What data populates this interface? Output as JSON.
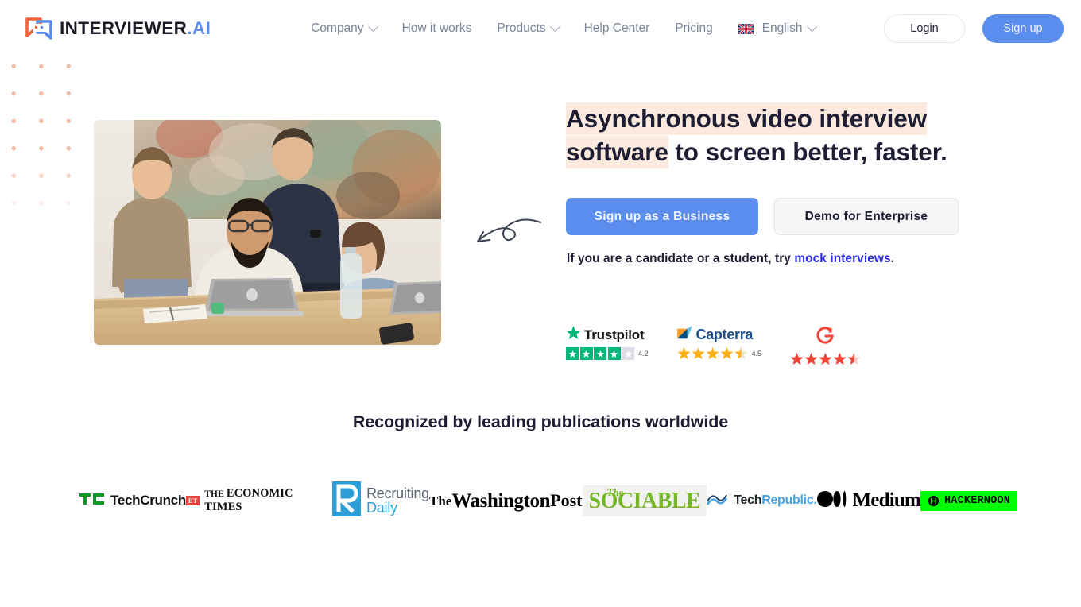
{
  "brand": {
    "logo_icon": "chat-bubbles-icon",
    "name_main": "INTERVIEWER",
    "name_suffix": ".AI",
    "accent_blue": "#5b8def",
    "accent_orange": "#f4623a",
    "highlight_peach": "#fdeadf"
  },
  "header": {
    "nav": [
      {
        "label": "Company",
        "has_dropdown": true
      },
      {
        "label": "How it works",
        "has_dropdown": false
      },
      {
        "label": "Products",
        "has_dropdown": true
      },
      {
        "label": "Help Center",
        "has_dropdown": false
      },
      {
        "label": "Pricing",
        "has_dropdown": false
      },
      {
        "label": "English",
        "has_dropdown": true,
        "icon": "uk-flag-icon"
      }
    ],
    "login_label": "Login",
    "signup_label": "Sign up"
  },
  "hero": {
    "headline_highlight": "Asynchronous video interview software",
    "headline_rest": " to screen better, faster.",
    "headline_line1_highlight": "Asynchronous video interview",
    "headline_line2_highlight": "software",
    "headline_line2_rest": " to screen better, faster.",
    "primary_cta": "Sign up as a Business",
    "secondary_cta": "Demo for Enterprise",
    "candidate_text": "If you are a candidate or a student, try ",
    "candidate_link": "mock interviews",
    "candidate_period": ".",
    "image_alt": "team-collaborating-around-laptops-photo",
    "arrow_icon": "curly-arrow-left-icon"
  },
  "reviews": [
    {
      "platform": "Trustpilot",
      "icon": "trustpilot-star-icon",
      "rating": "4.2",
      "filled": 4,
      "half": 0,
      "total": 5,
      "color": "#00b67a"
    },
    {
      "platform": "Capterra",
      "icon": "capterra-arrow-icon",
      "rating": "4.5",
      "filled": 4,
      "half": 1,
      "total": 5,
      "color": "#ff9d28"
    },
    {
      "platform": "G2",
      "icon": "g2-logo-icon",
      "rating": "",
      "filled": 4,
      "half": 1,
      "total": 5,
      "color": "#ef4438"
    }
  ],
  "publications": {
    "heading": "Recognized by leading publications worldwide",
    "logos": [
      {
        "name": "TechCrunch",
        "part1": "Tech",
        "part2": "Crunch",
        "icon": "techcrunch-logo-icon"
      },
      {
        "name": "The Economic Times",
        "badge": "ET",
        "text_small": "THE ",
        "text_main": "ECONOMIC TIMES",
        "icon": "economic-times-logo-icon"
      },
      {
        "name": "Recruiting Daily",
        "line1": "Recruiting",
        "line2": "Daily",
        "icon": "recruiting-daily-logo-icon"
      },
      {
        "name": "The Washington Post",
        "line1": "The",
        "line2": "Washington",
        "line3": "Post",
        "icon": "washington-post-logo-icon"
      },
      {
        "name": "The Sociable",
        "small": "The",
        "main": "SOCIABLE",
        "icon": "sociable-logo-icon"
      },
      {
        "name": "TechRepublic",
        "part1": "Tech",
        "part2": "Republic.",
        "icon": "techrepublic-logo-icon"
      },
      {
        "name": "Medium",
        "text": "Medium",
        "icon": "medium-logo-icon"
      },
      {
        "name": "HackerNoon",
        "text": "HACKERNOON",
        "icon": "hackernoon-logo-icon"
      }
    ]
  }
}
